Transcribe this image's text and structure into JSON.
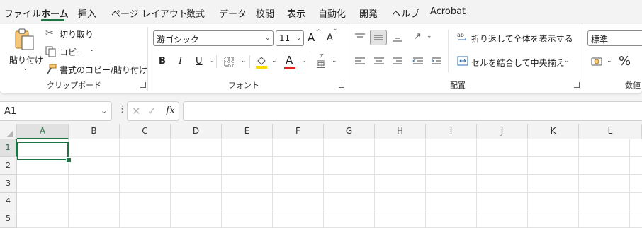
{
  "menu": {
    "tabs": [
      "ファイル",
      "ホーム",
      "挿入",
      "ページ レイアウト",
      "数式",
      "データ",
      "校閲",
      "表示",
      "自動化",
      "開発",
      "ヘルプ",
      "Acrobat"
    ],
    "active_tab": "ホーム"
  },
  "ribbon": {
    "clipboard": {
      "paste": "貼り付け",
      "cut": "切り取り",
      "copy": "コピー",
      "format_painter": "書式のコピー/貼り付け",
      "group_label": "クリップボード"
    },
    "font": {
      "font_name": "游ゴシック",
      "font_size": "11",
      "bold": "B",
      "italic": "I",
      "underline": "U",
      "font_color_glyph": "A",
      "phonetic_glyph": "亜",
      "phonetic_ruby": "ア",
      "increase_glyph": "A",
      "decrease_glyph": "A",
      "group_label": "フォント",
      "highlight_color": "#ffd800",
      "font_color": "#d8262c"
    },
    "alignment": {
      "wrap_text": "折り返して全体を表示する",
      "merge_center": "セルを結合して中央揃え",
      "group_label": "配置"
    },
    "number": {
      "format": "標準",
      "percent": "%",
      "group_label": "数値"
    }
  },
  "formula_bar": {
    "name_box": "A1",
    "fx": "fx",
    "formula": ""
  },
  "grid": {
    "columns": [
      "A",
      "B",
      "C",
      "D",
      "E",
      "F",
      "G",
      "H",
      "I",
      "J",
      "K",
      "L"
    ],
    "rows": [
      "1",
      "2",
      "3",
      "4",
      "5"
    ],
    "active_cell": "A1"
  },
  "colors": {
    "accent": "#217346",
    "ribbon_bg": "#ffffff",
    "app_bg": "#f3f3f3"
  }
}
